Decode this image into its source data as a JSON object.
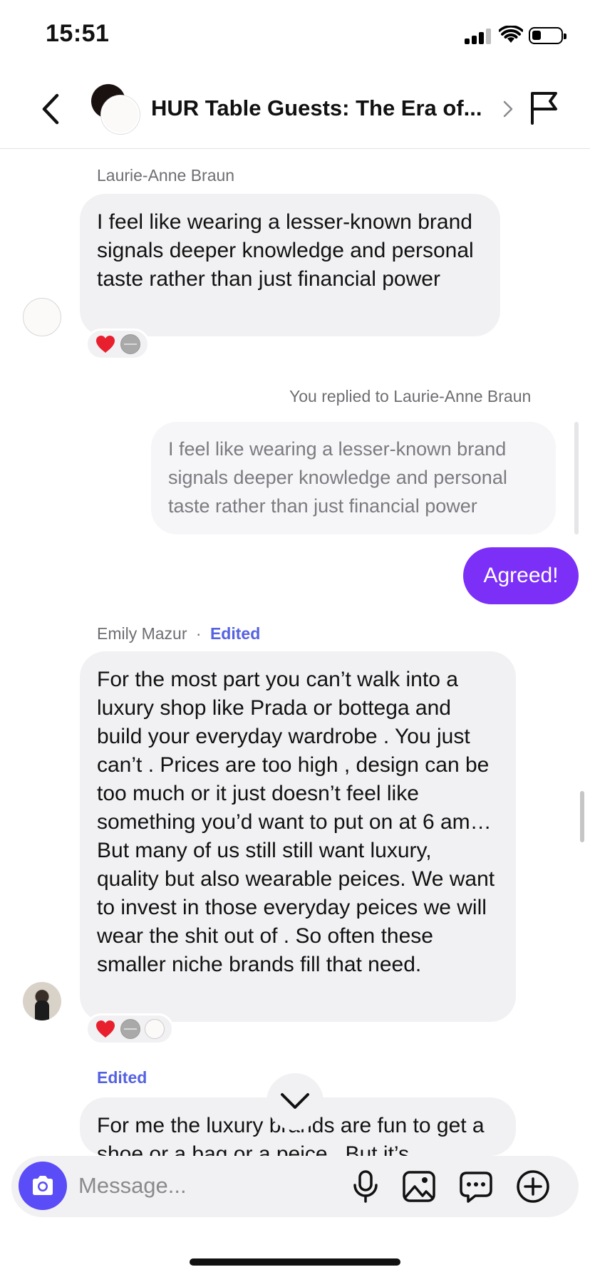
{
  "status_bar": {
    "time": "15:51",
    "battery_level": 0.25
  },
  "header": {
    "title": "HUR Table Guests: The Era of..."
  },
  "messages": {
    "m1": {
      "sender": "Laurie-Anne Braun",
      "text": "I feel like wearing a lesser-known brand signals deeper knowledge and personal taste rather than just financial power",
      "reactions": [
        "❤️"
      ]
    },
    "reply": {
      "context": "You replied to Laurie-Anne Braun",
      "quoted": "I feel like wearing a lesser-known brand signals deeper knowledge and personal taste rather than just financial power",
      "text": "Agreed!"
    },
    "m2": {
      "sender": "Emily Mazur",
      "separator": "·",
      "edited": "Edited",
      "text": "For the most part you can’t walk into a luxury shop like Prada or bottega and build your everyday wardrobe . You just can’t . Prices are too high , design can be too much or it just doesn’t feel like something you’d want to put on at 6 am… But many of us still still want luxury, quality but also wearable peices. We want to invest in those everyday peices we will wear the shit out of . So often these smaller niche brands fill that need.",
      "reactions": [
        "❤️"
      ]
    },
    "m3": {
      "edited": "Edited",
      "text": "For me the luxury brands are fun to get a shoe or a bag or a peice . But it’s"
    }
  },
  "composer": {
    "placeholder": "Message..."
  },
  "icons": {
    "back": "chevron-left-icon",
    "flag": "flag-icon",
    "camera": "camera-icon",
    "mic": "microphone-icon",
    "gallery": "image-icon",
    "sticker": "chat-bubble-icon",
    "add": "plus-circle-icon",
    "jump": "chevron-down-icon"
  },
  "colors": {
    "outgoing_bubble": "#7b2ff7",
    "camera_button": "#5a4cf6",
    "edited_label": "#5562e0",
    "incoming_bubble": "#f1f1f3"
  }
}
